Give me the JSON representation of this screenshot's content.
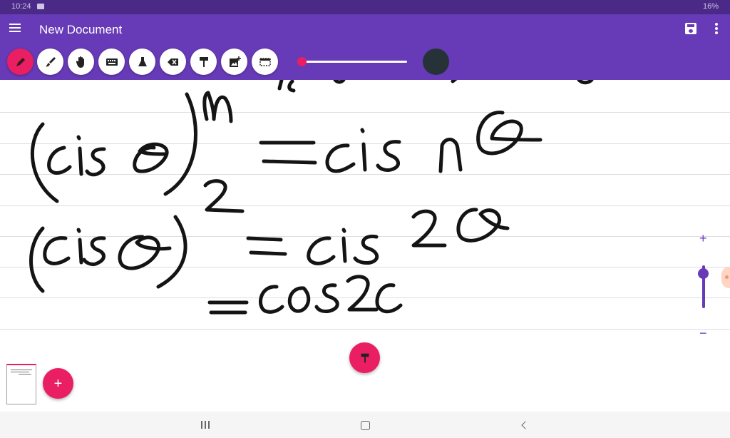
{
  "status_bar": {
    "time": "10:24",
    "battery": "16%"
  },
  "app_bar": {
    "title": "New Document"
  },
  "toolbar": {
    "tools": [
      {
        "name": "pen-icon",
        "active": true
      },
      {
        "name": "brush-icon",
        "active": false
      },
      {
        "name": "hand-icon",
        "active": false
      },
      {
        "name": "keyboard-icon",
        "active": false
      },
      {
        "name": "flask-icon",
        "active": false
      },
      {
        "name": "backspace-icon",
        "active": false
      },
      {
        "name": "paint-roller-icon",
        "active": false
      },
      {
        "name": "add-image-icon",
        "active": false
      },
      {
        "name": "selection-icon",
        "active": false
      }
    ],
    "stroke_width_fraction": 0.0,
    "pen_color": "#263238",
    "accent_color": "#e91e63"
  },
  "canvas": {
    "background": "#ffffff",
    "ink_color": "#141414",
    "handwriting": "(cis θ)^n = cis nθ ; (cis θ)^2 = cis 2θ = cos 2θ"
  },
  "zoom": {
    "plus": "+",
    "minus": "−"
  },
  "fab": {
    "add_label": "+"
  },
  "colors": {
    "primary": "#673ab7",
    "status": "#4a2a86",
    "accent": "#e91e63"
  }
}
